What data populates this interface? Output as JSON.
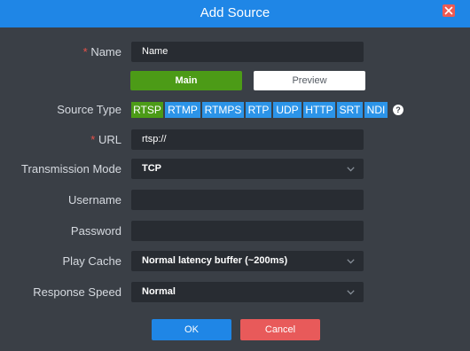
{
  "dialog": {
    "title": "Add Source"
  },
  "colors": {
    "titlebar": "#1f86e6",
    "background": "#3a3f46",
    "active_green": "#4c9b17",
    "chip_blue": "#2c94e8",
    "cancel_red": "#e85a5a",
    "close_red": "#ee5a52"
  },
  "form": {
    "name": {
      "required_mark": "*",
      "label": "Name",
      "value": "Name"
    },
    "stream_toggle": {
      "main": "Main",
      "preview": "Preview",
      "selected": "Main"
    },
    "source_type": {
      "label": "Source Type",
      "options": [
        "RTSP",
        "RTMP",
        "RTMPS",
        "RTP",
        "UDP",
        "HTTP",
        "SRT",
        "NDI"
      ],
      "selected": "RTSP",
      "help_glyph": "?"
    },
    "url": {
      "required_mark": "*",
      "label": "URL",
      "value": "rtsp://"
    },
    "transmission_mode": {
      "label": "Transmission Mode",
      "value": "TCP"
    },
    "username": {
      "label": "Username",
      "value": ""
    },
    "password": {
      "label": "Password",
      "value": ""
    },
    "play_cache": {
      "label": "Play Cache",
      "value": "Normal latency buffer (~200ms)"
    },
    "response_speed": {
      "label": "Response Speed",
      "value": "Normal"
    }
  },
  "buttons": {
    "ok": "OK",
    "cancel": "Cancel"
  }
}
